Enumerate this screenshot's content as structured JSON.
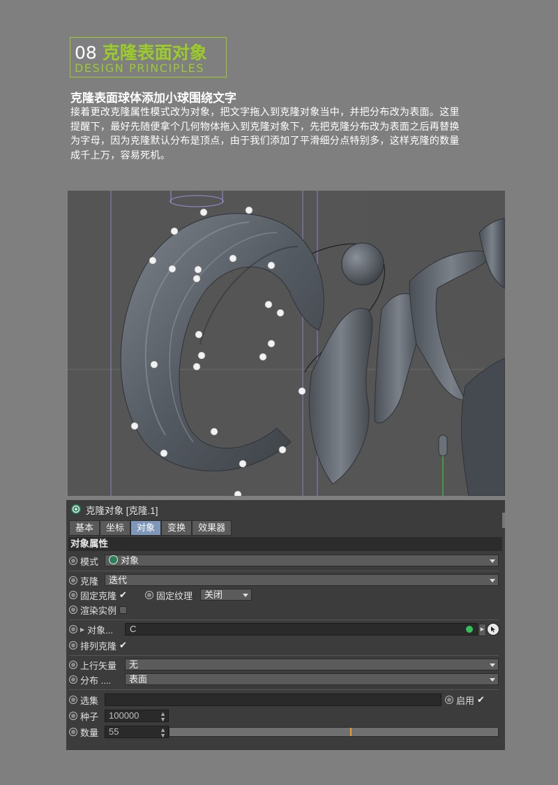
{
  "header": {
    "number": "08",
    "title": "克隆表面对象",
    "subtitle": "DESIGN PRINCIPLES",
    "accent_color": "#9ccc29"
  },
  "article": {
    "heading": "克隆表面球体添加小球围绕文字",
    "lines": [
      "接着更改克隆属性模式改为对象，把文字拖入到克隆对象当中，并把分布改为表面。这里",
      "提醒下，最好先随便拿个几何物体拖入到克隆对象下，先把克隆分布改为表面之后再替换",
      "为字母，因为克隆默认分布是顶点，由于我们添加了平滑细分点特别多，这样克隆的数量",
      "成千上万，容易死机。"
    ]
  },
  "panel": {
    "title": "克隆对象 [克隆.1]",
    "title_icon": "cloner-icon",
    "tabs": [
      "基本",
      "坐标",
      "对象",
      "变换",
      "效果器"
    ],
    "active_tab": "对象",
    "section": "对象属性",
    "mode_label": "模式",
    "mode_value": "对象",
    "clone_label": "克隆",
    "clone_value": "迭代",
    "fixed_clone_label": "固定克隆",
    "fixed_texture_label": "固定纹理",
    "fixed_texture_value": "关闭",
    "render_instance_label": "渲染实例",
    "object_label": "对象...",
    "object_value": "C",
    "arrange_clone_label": "排列克隆",
    "up_vector_label": "上行矢量",
    "up_vector_value": "无",
    "distribution_label": "分布 ....",
    "distribution_value": "表面",
    "selection_label": "选集",
    "enable_label": "启用",
    "seed_label": "种子",
    "seed_value": "100000",
    "count_label": "数量",
    "count_value": "55",
    "count_slider_fraction": 0.55,
    "check_glyph": "✔",
    "active_tab_color": "#7f98b9",
    "slider_mark_color": "#f29d1c"
  }
}
